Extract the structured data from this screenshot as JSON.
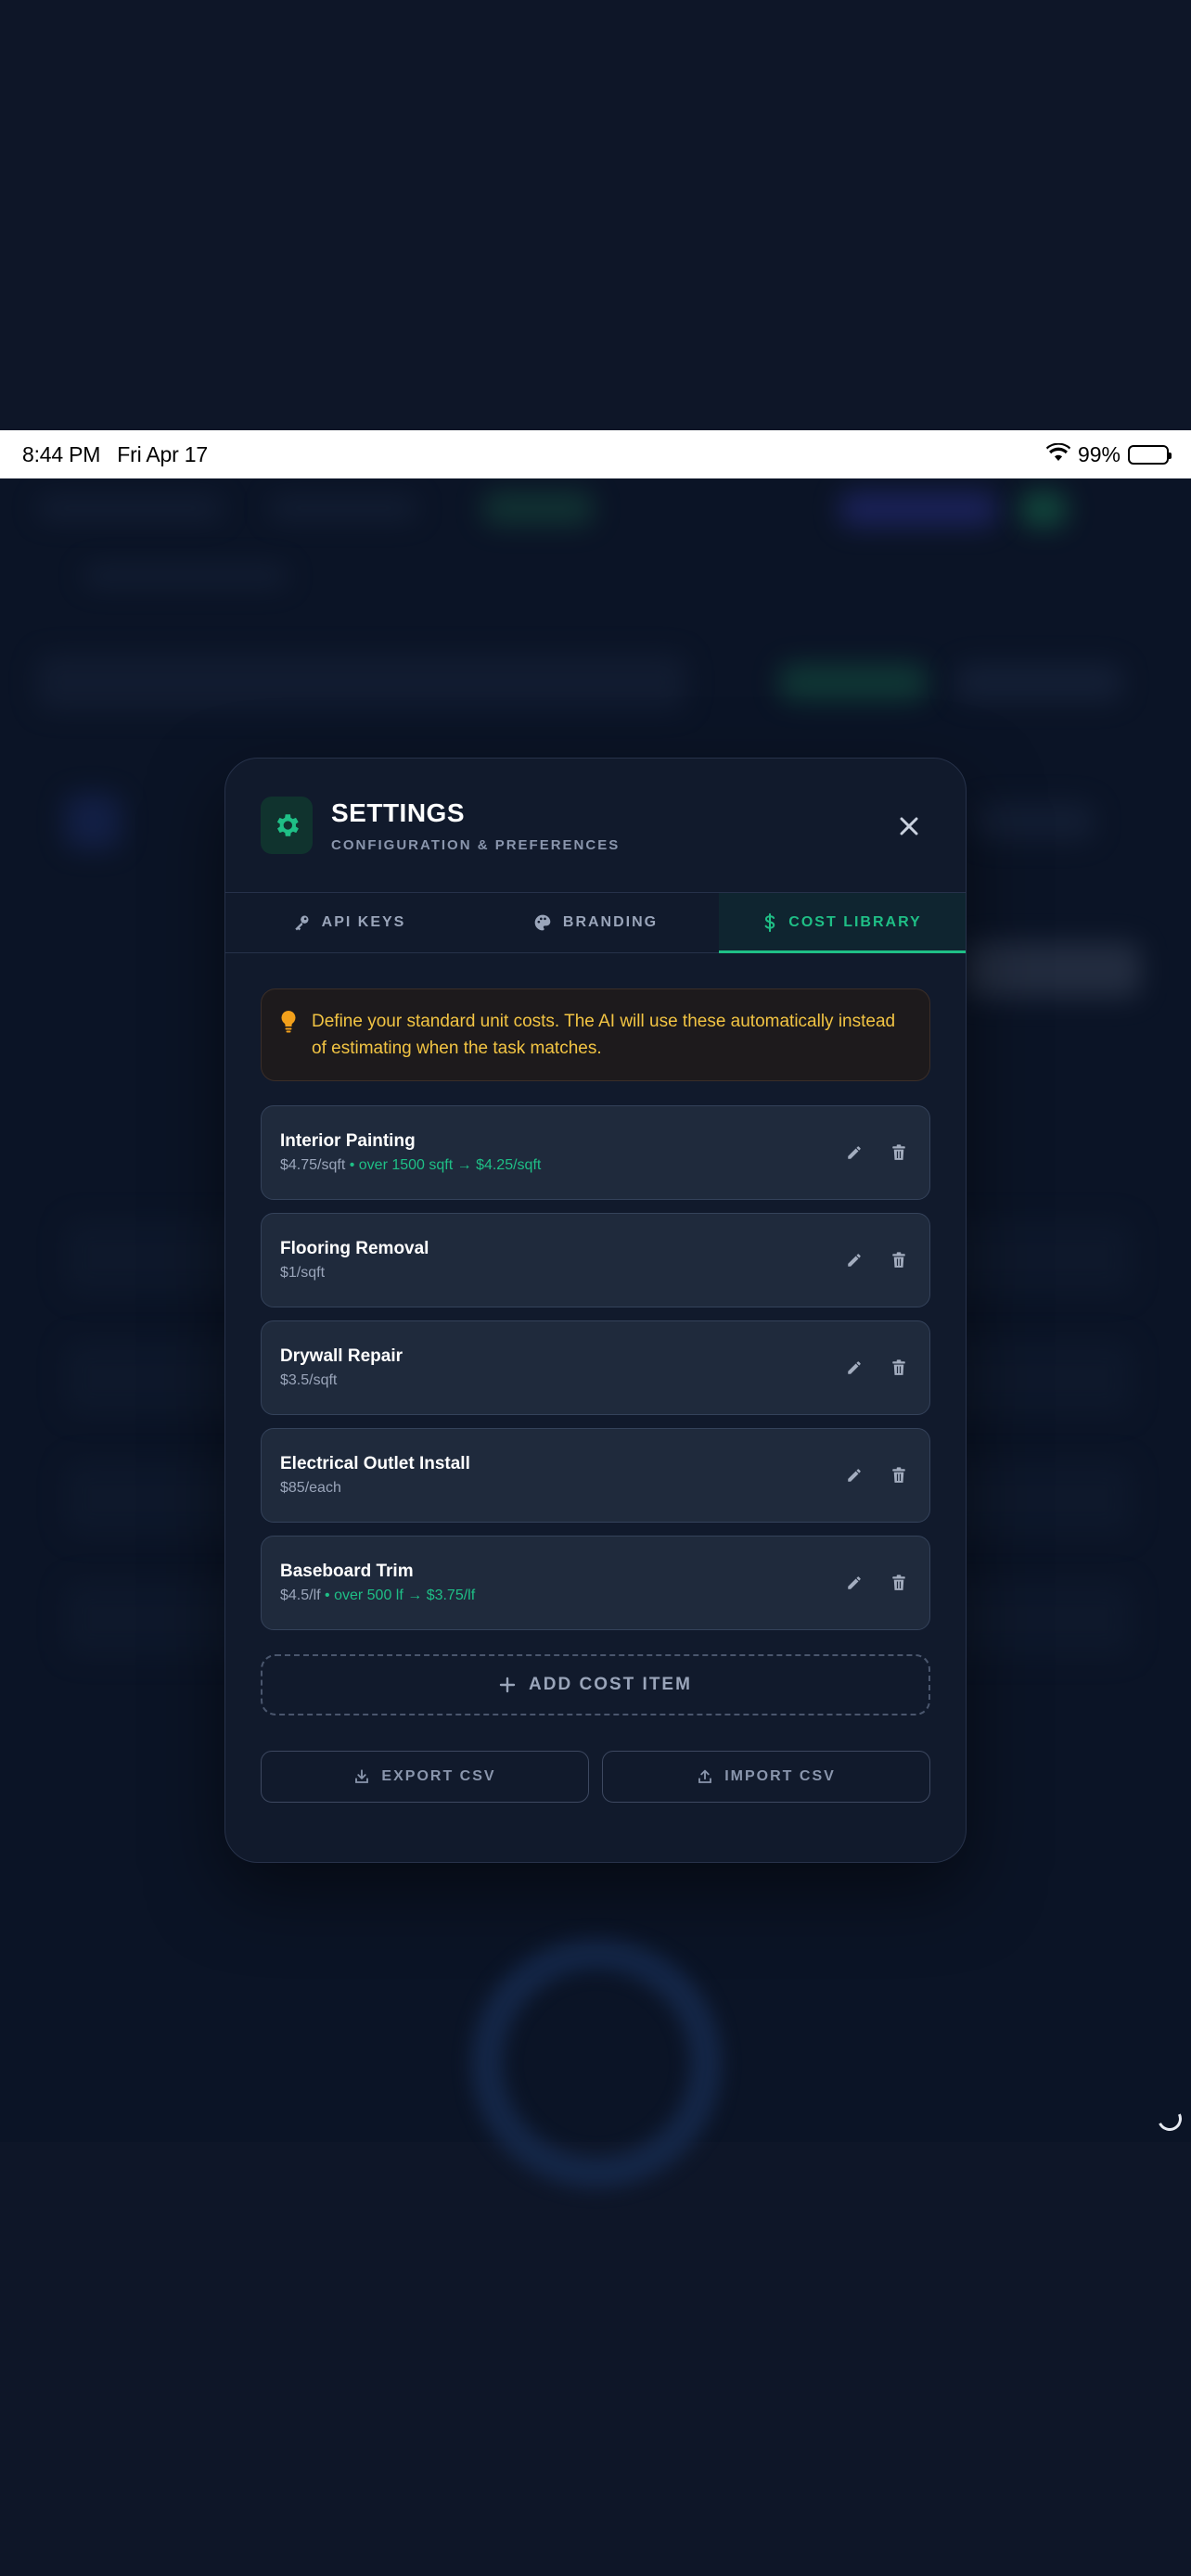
{
  "status_bar": {
    "time": "8:44 PM",
    "date": "Fri Apr 17",
    "battery": "99%"
  },
  "modal": {
    "title": "SETTINGS",
    "subtitle": "CONFIGURATION & PREFERENCES",
    "tabs": [
      {
        "label": "API KEYS",
        "icon": "key-icon",
        "active": false
      },
      {
        "label": "BRANDING",
        "icon": "palette-icon",
        "active": false
      },
      {
        "label": "COST LIBRARY",
        "icon": "dollar-icon",
        "active": true
      }
    ],
    "tip": "Define your standard unit costs. The AI will use these automatically instead of estimating when the task matches.",
    "items": [
      {
        "name": "Interior Painting",
        "price": "$4.75/sqft",
        "tier": " • over 1500 sqft → $4.25/sqft"
      },
      {
        "name": "Flooring Removal",
        "price": "$1/sqft",
        "tier": ""
      },
      {
        "name": "Drywall Repair",
        "price": "$3.5/sqft",
        "tier": ""
      },
      {
        "name": "Electrical Outlet Install",
        "price": "$85/each",
        "tier": ""
      },
      {
        "name": "Baseboard Trim",
        "price": "$4.5/lf",
        "tier": " • over 500 lf → $3.75/lf"
      }
    ],
    "add_label": "ADD COST ITEM",
    "export_label": "EXPORT CSV",
    "import_label": "IMPORT CSV"
  },
  "colors": {
    "accent": "#1fbf86",
    "tip_text": "#f2c443",
    "modal_bg": "#111a2c"
  }
}
